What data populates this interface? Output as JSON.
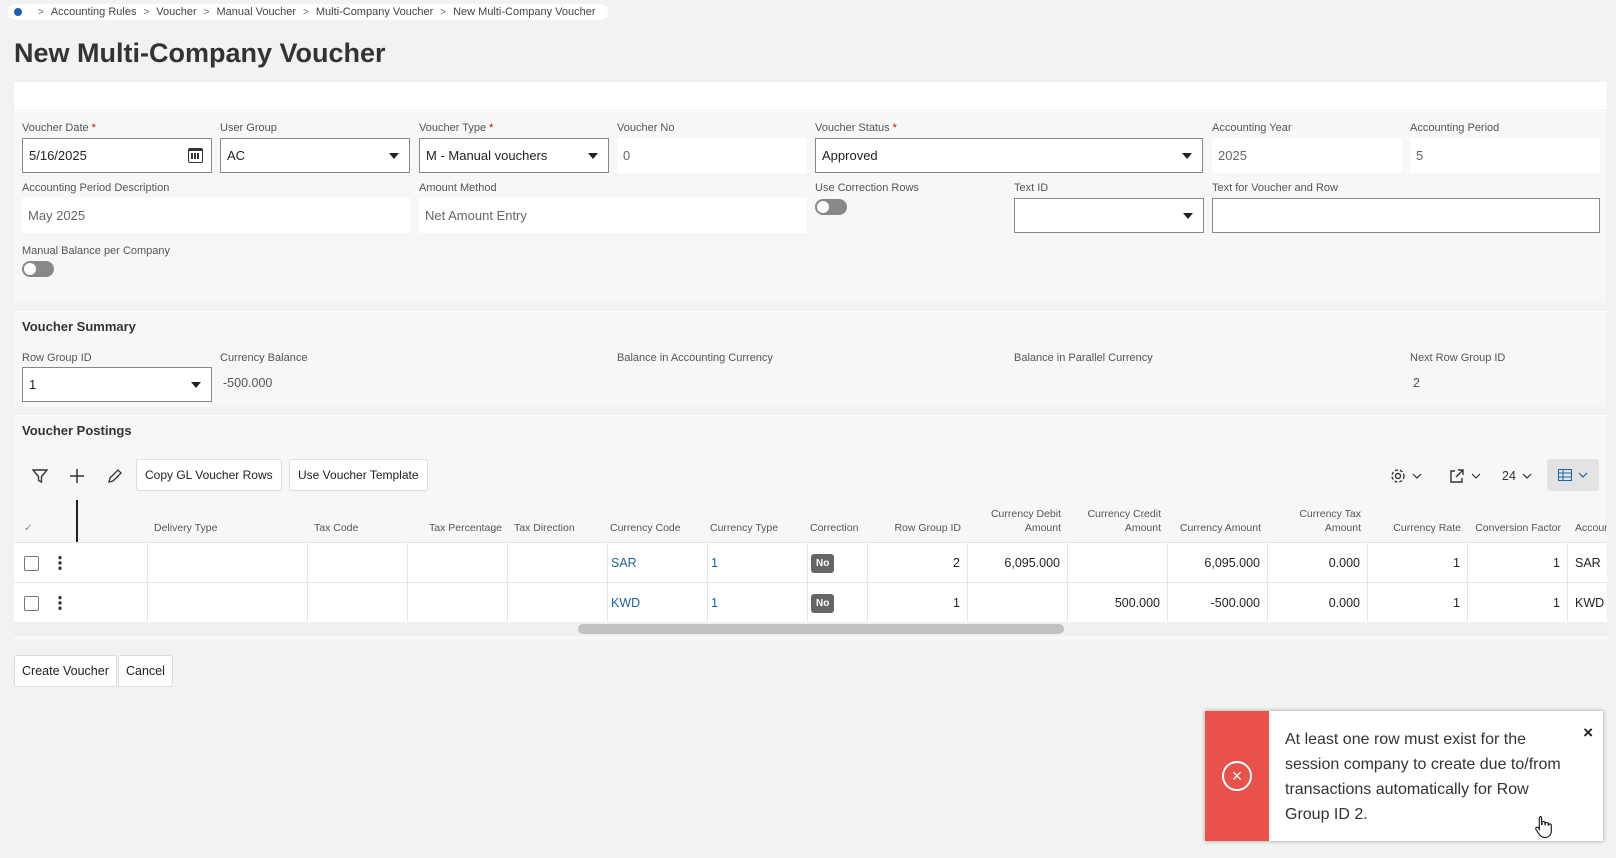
{
  "breadcrumb": [
    "Accounting Rules",
    "Voucher",
    "Manual Voucher",
    "Multi-Company Voucher",
    "New Multi-Company Voucher"
  ],
  "page_title": "New Multi-Company Voucher",
  "form": {
    "voucher_date": {
      "label": "Voucher Date",
      "value": "5/16/2025"
    },
    "user_group": {
      "label": "User Group",
      "value": "AC"
    },
    "voucher_type": {
      "label": "Voucher Type",
      "value": "M - Manual vouchers"
    },
    "voucher_no": {
      "label": "Voucher No",
      "value": "0"
    },
    "voucher_status": {
      "label": "Voucher Status",
      "value": "Approved"
    },
    "accounting_year": {
      "label": "Accounting Year",
      "value": "2025"
    },
    "accounting_period": {
      "label": "Accounting Period",
      "value": "5"
    },
    "period_description": {
      "label": "Accounting Period Description",
      "value": "May 2025"
    },
    "amount_method": {
      "label": "Amount Method",
      "value": "Net Amount Entry"
    },
    "use_correction_rows": {
      "label": "Use Correction Rows",
      "on": false
    },
    "text_id": {
      "label": "Text ID",
      "value": ""
    },
    "text_voucher_row": {
      "label": "Text for Voucher and Row",
      "value": ""
    },
    "manual_balance": {
      "label": "Manual Balance per Company",
      "on": false
    },
    "required_mark": "*"
  },
  "summary": {
    "title": "Voucher Summary",
    "row_group_id": {
      "label": "Row Group ID",
      "value": "1"
    },
    "currency_balance": {
      "label": "Currency Balance",
      "value": "-500.000"
    },
    "balance_accounting": {
      "label": "Balance in Accounting Currency",
      "value": ""
    },
    "balance_parallel": {
      "label": "Balance in Parallel Currency",
      "value": ""
    },
    "next_row_group_id": {
      "label": "Next Row Group ID",
      "value": "2"
    }
  },
  "postings": {
    "title": "Voucher Postings",
    "toolbar": {
      "copy_gl": "Copy GL Voucher Rows",
      "use_template": "Use Voucher Template",
      "page_size": "24"
    },
    "columns": [
      "Delivery Type",
      "Tax Code",
      "Tax Percentage",
      "Tax Direction",
      "Currency Code",
      "Currency Type",
      "Correction",
      "Row Group ID",
      "Currency Debit Amount",
      "Currency Credit Amount",
      "Currency Amount",
      "Currency Tax Amount",
      "Currency Rate",
      "Conversion Factor",
      "Accoun"
    ],
    "rows": [
      {
        "currency_code": "SAR",
        "currency_type": "1",
        "correction": "No",
        "row_group_id": "2",
        "debit": "6,095.000",
        "credit": "",
        "amount": "6,095.000",
        "tax_amount": "0.000",
        "rate": "1",
        "conversion": "1",
        "account": "SAR"
      },
      {
        "currency_code": "KWD",
        "currency_type": "1",
        "correction": "No",
        "row_group_id": "1",
        "debit": "",
        "credit": "500.000",
        "amount": "-500.000",
        "tax_amount": "0.000",
        "rate": "1",
        "conversion": "1",
        "account": "KWD"
      }
    ]
  },
  "buttons": {
    "create": "Create Voucher",
    "cancel": "Cancel"
  },
  "toast": {
    "message": "At least one row must exist for the session company to create due to/from transactions automatically for Row Group ID 2.",
    "close": "×",
    "icon_glyph": "×",
    "color": "#e8524a"
  },
  "colors": {
    "link": "#1a64a5",
    "error": "#e8524a",
    "accent": "#1a5fb4"
  }
}
